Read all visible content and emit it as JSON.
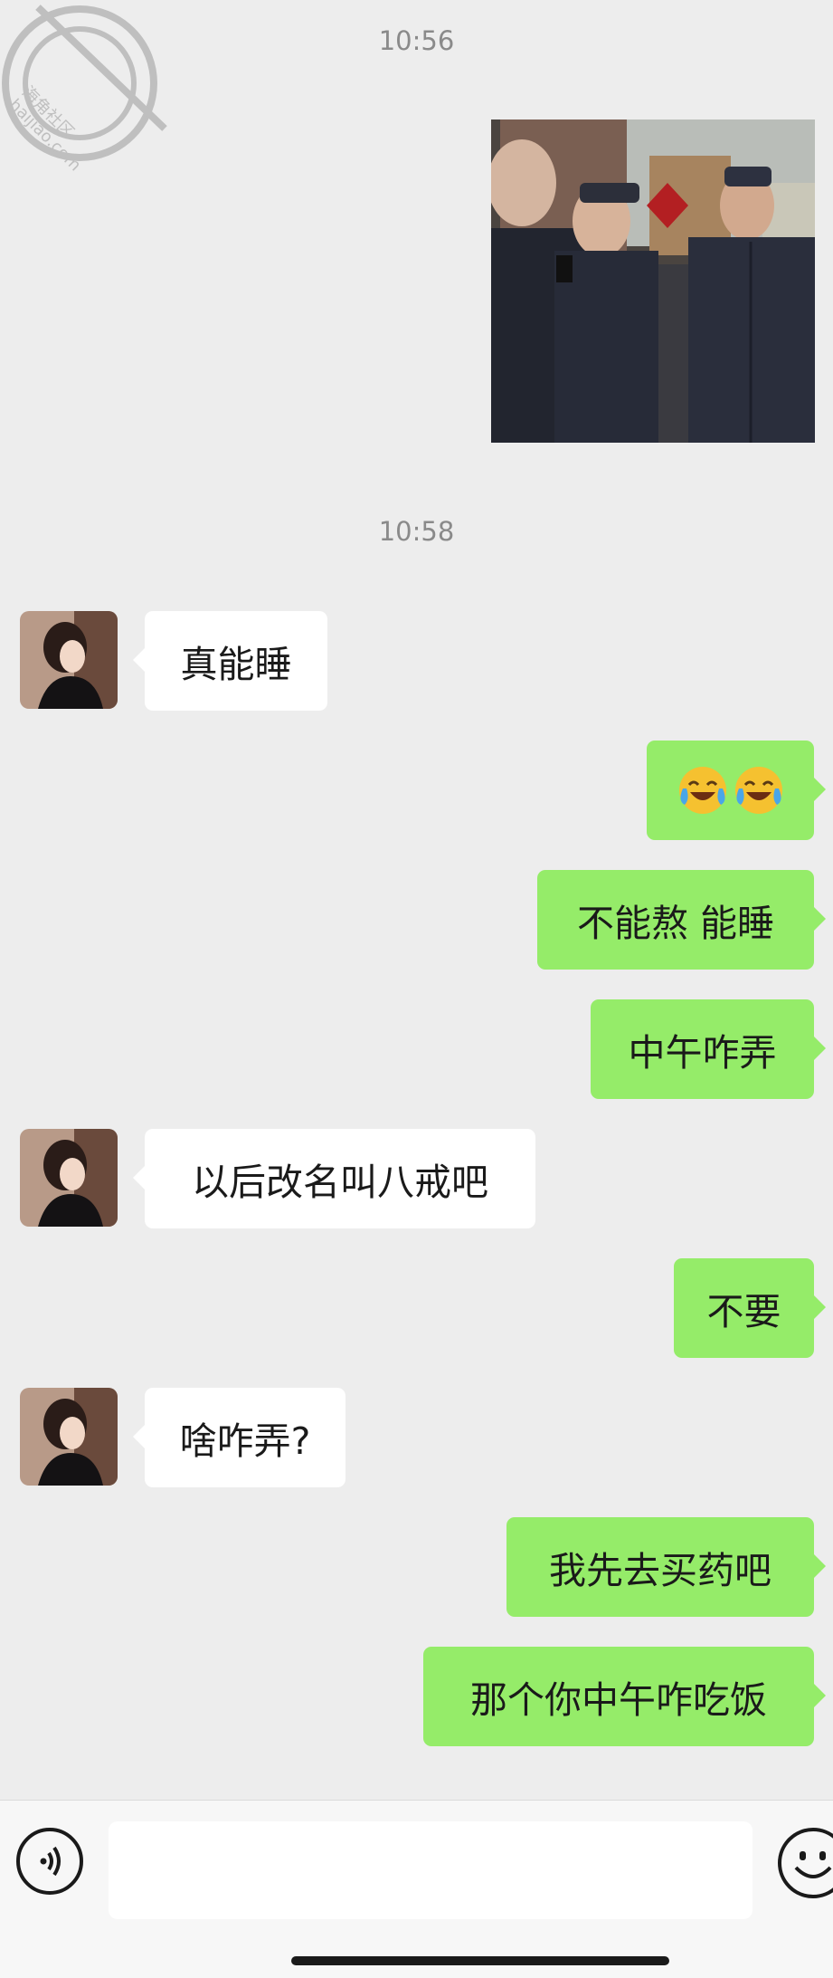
{
  "watermark": {
    "text_line1": "海角社区",
    "text_line2": "haijiao.com"
  },
  "timestamps": [
    "10:56",
    "10:58"
  ],
  "messages": [
    {
      "side": "in",
      "text": "真能睡",
      "avatar": "avatar-icon"
    },
    {
      "side": "out",
      "text": "",
      "emoji": [
        "laugh-cry-emoji",
        "laugh-cry-emoji"
      ]
    },
    {
      "side": "out",
      "text": "不能熬 能睡"
    },
    {
      "side": "out",
      "text": "中午咋弄"
    },
    {
      "side": "in",
      "text": "以后改名叫八戒吧",
      "avatar": "avatar-icon"
    },
    {
      "side": "out",
      "text": "不要"
    },
    {
      "side": "in",
      "text": "啥咋弄?",
      "avatar": "avatar-icon"
    },
    {
      "side": "out",
      "text": "我先去买药吧"
    },
    {
      "side": "out",
      "text": "那个你中午咋吃饭"
    }
  ],
  "input_bar": {
    "voice_icon": "voice-icon",
    "emoji_icon": "emoji-icon",
    "input_value": "",
    "input_placeholder": ""
  },
  "colors": {
    "background": "#ededed",
    "outgoing_bubble": "#95ec69",
    "incoming_bubble": "#ffffff",
    "timestamp_text": "#8a8a8a"
  }
}
